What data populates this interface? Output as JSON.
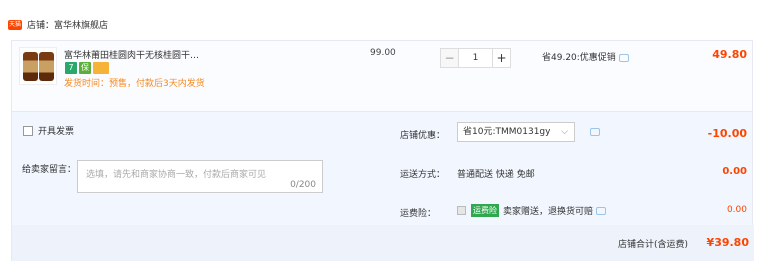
{
  "shop": {
    "badge": "天猫",
    "name": "店铺：富华林旗舰店"
  },
  "item": {
    "thumb_tag": "TMALL",
    "title": "富华林莆田桂圆肉干无核桂圆干…",
    "icons": [
      "7",
      "保",
      ""
    ],
    "shipping_note": "发货时间：预售，付款后3天内发货",
    "price": "99.00",
    "quantity": "1",
    "minus": "−",
    "plus": "+",
    "promo": "省49.20:优惠促销",
    "subtotal": "49.80"
  },
  "invoice": {
    "label": "开具发票"
  },
  "memo": {
    "label": "给卖家留言：",
    "placeholder": "选填，请先和商家协商一致，付款后商家可见",
    "count": "0/200"
  },
  "coupon": {
    "label": "店铺优惠：",
    "value": "省10元:TMM0131gy",
    "chevron": "⌵",
    "amount": "-10.00"
  },
  "shipping": {
    "label": "运送方式：",
    "value": "普通配送 快递 免邮",
    "fee": "0.00"
  },
  "insurance": {
    "label": "运费险：",
    "badge": "运费险",
    "text": "卖家赠送，退换货可赔",
    "fee": "0.00"
  },
  "total": {
    "label": "店铺合计(含运费)",
    "value": "¥39.80"
  },
  "colors": {
    "accent": "#ff4400",
    "panel": "#f2f7ff"
  }
}
